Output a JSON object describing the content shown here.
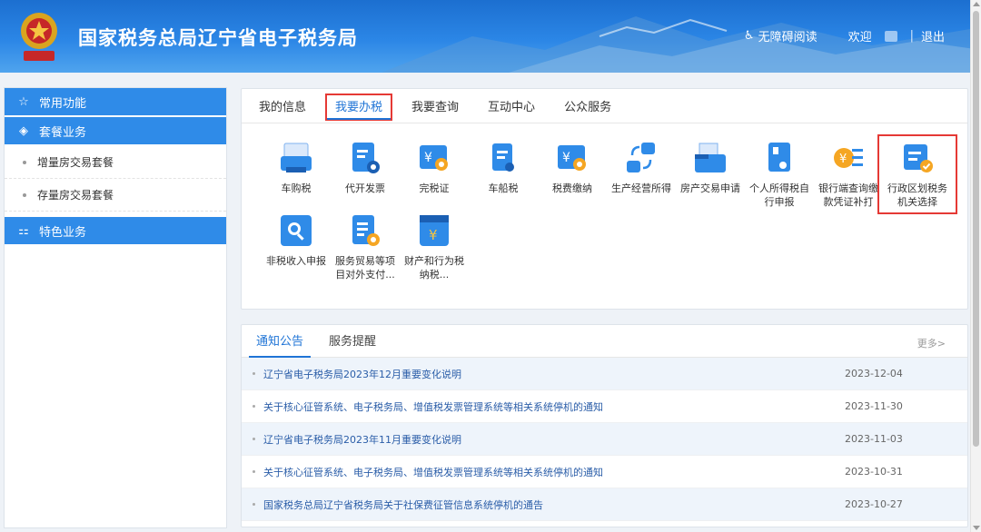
{
  "header": {
    "title": "国家税务总局辽宁省电子税务局",
    "accessibility": "无障碍阅读",
    "welcome": "欢迎",
    "separator": "|",
    "logout": "退出",
    "brand_color": "#2b86e6"
  },
  "sidebar": {
    "sections": [
      {
        "label": "常用功能",
        "icon": "star-icon"
      },
      {
        "label": "套餐业务",
        "icon": "layers-icon"
      },
      {
        "label": "特色业务",
        "icon": "apps-icon"
      }
    ],
    "package_items": [
      "增量房交易套餐",
      "存量房交易套餐"
    ]
  },
  "main": {
    "tabs": [
      {
        "label": "我的信息"
      },
      {
        "label": "我要办税",
        "active": true
      },
      {
        "label": "我要查询"
      },
      {
        "label": "互动中心"
      },
      {
        "label": "公众服务"
      }
    ],
    "items": [
      {
        "label": "车购税",
        "icon": "vehicle-purchase-tax-icon"
      },
      {
        "label": "代开发票",
        "icon": "invoice-icon"
      },
      {
        "label": "完税证",
        "icon": "tax-certificate-icon"
      },
      {
        "label": "车船税",
        "icon": "vehicle-vessel-tax-icon"
      },
      {
        "label": "税费缴纳",
        "icon": "tax-payment-icon"
      },
      {
        "label": "生产经营所得",
        "icon": "business-income-icon"
      },
      {
        "label": "房产交易申请",
        "icon": "property-transaction-icon"
      },
      {
        "label": "个人所得税自行申报",
        "icon": "personal-income-tax-icon"
      },
      {
        "label": "银行端查询缴款凭证补打",
        "icon": "bank-receipt-icon"
      },
      {
        "label": "行政区划税务机关选择",
        "icon": "tax-office-select-icon"
      },
      {
        "label": "非税收入申报",
        "icon": "non-tax-revenue-icon"
      },
      {
        "label": "服务贸易等项目对外支付...",
        "icon": "foreign-payment-icon"
      },
      {
        "label": "财产和行为税纳税...",
        "icon": "property-behavior-tax-icon"
      }
    ]
  },
  "notices": {
    "tabs": [
      {
        "label": "通知公告",
        "active": true
      },
      {
        "label": "服务提醒"
      }
    ],
    "more": "更多>",
    "rows": [
      {
        "title": "辽宁省电子税务局2023年12月重要变化说明",
        "date": "2023-12-04"
      },
      {
        "title": "关于核心征管系统、电子税务局、增值税发票管理系统等相关系统停机的通知",
        "date": "2023-11-30"
      },
      {
        "title": "辽宁省电子税务局2023年11月重要变化说明",
        "date": "2023-11-03"
      },
      {
        "title": "关于核心征管系统、电子税务局、增值税发票管理系统等相关系统停机的通知",
        "date": "2023-10-31"
      },
      {
        "title": "国家税务总局辽宁省税务局关于社保费征管信息系统停机的通告",
        "date": "2023-10-27"
      }
    ]
  }
}
